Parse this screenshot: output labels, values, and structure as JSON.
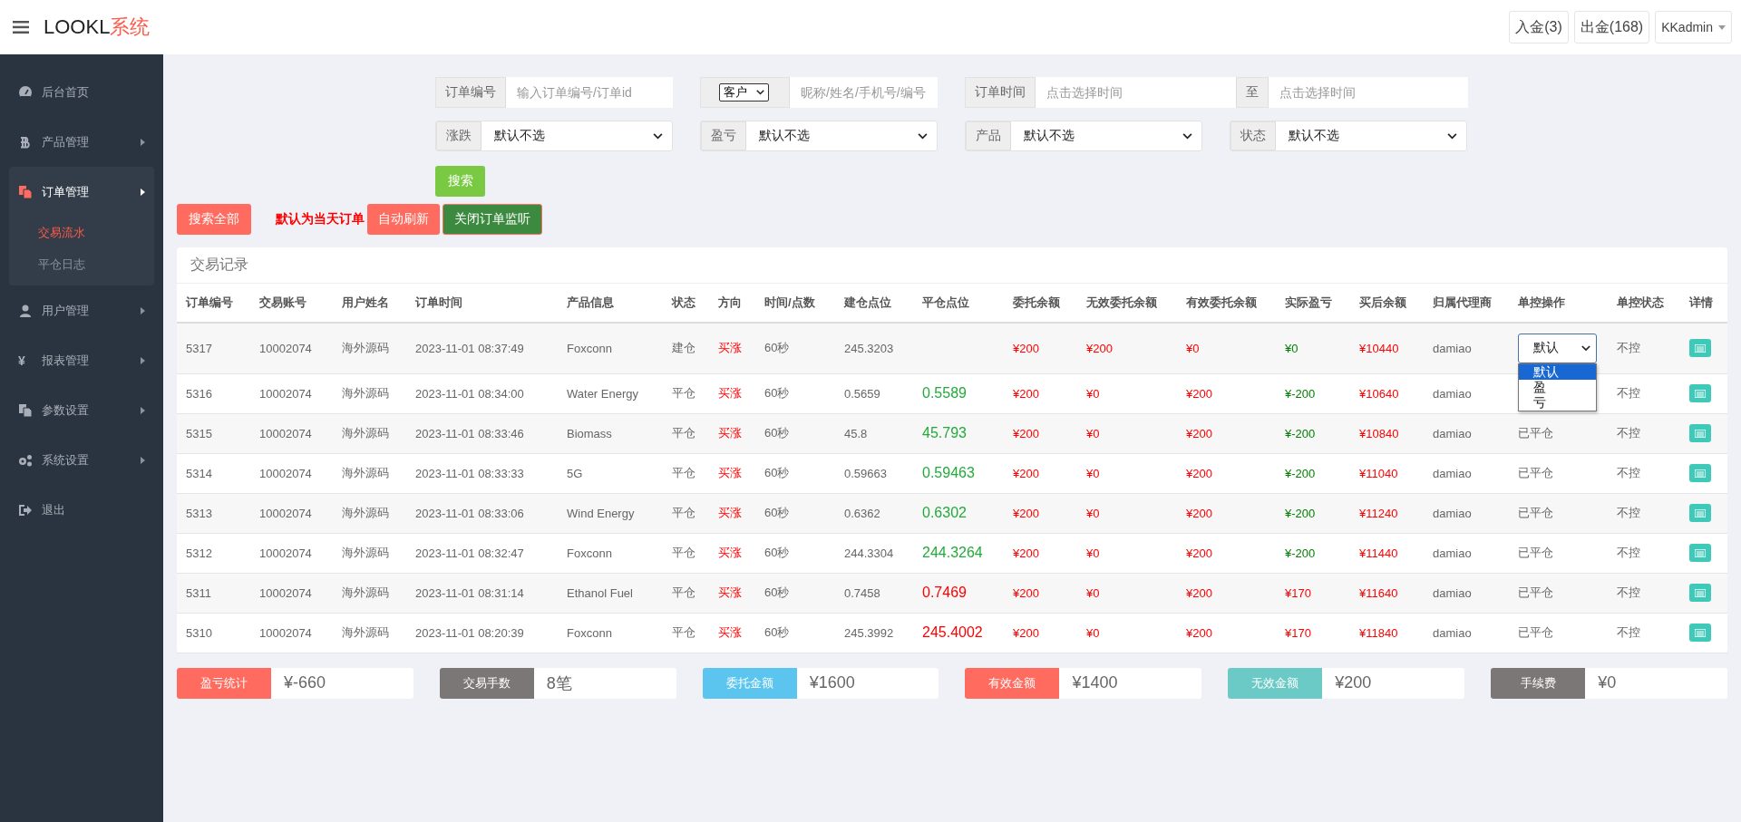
{
  "header": {
    "logo_main": "LOOKL",
    "logo_accent": "系统",
    "buttons": [
      "入金(3)",
      "出金(168)"
    ],
    "user": "KKadmin"
  },
  "sidebar": {
    "items": [
      {
        "label": "后台首页",
        "arrow": false,
        "expanded": false
      },
      {
        "label": "产品管理",
        "arrow": true,
        "expanded": false
      },
      {
        "label": "订单管理",
        "arrow": true,
        "expanded": true,
        "children": [
          {
            "label": "交易流水",
            "selected": true
          },
          {
            "label": "平仓日志",
            "selected": false
          }
        ]
      },
      {
        "label": "用户管理",
        "arrow": true,
        "expanded": false
      },
      {
        "label": "报表管理",
        "arrow": true,
        "expanded": false,
        "glyph": "¥"
      },
      {
        "label": "参数设置",
        "arrow": true,
        "expanded": false
      },
      {
        "label": "系统设置",
        "arrow": true,
        "expanded": false
      },
      {
        "label": "退出",
        "arrow": false,
        "expanded": false
      }
    ]
  },
  "filters": {
    "row1": [
      {
        "kind": "text",
        "label": "订单编号",
        "placeholder": "输入订单编号/订单id"
      },
      {
        "kind": "select-text",
        "select": "客户",
        "placeholder": "昵称/姓名/手机号/编号"
      },
      {
        "kind": "range",
        "label": "订单时间",
        "placeholder": "点击选择时间",
        "separator": "至",
        "placeholder2": "点击选择时间"
      }
    ],
    "row2": [
      {
        "label": "涨跌",
        "value": "默认不选"
      },
      {
        "label": "盈亏",
        "value": "默认不选"
      },
      {
        "label": "产品",
        "value": "默认不选"
      },
      {
        "label": "状态",
        "value": "默认不选"
      }
    ],
    "search_button": "搜索"
  },
  "actions": {
    "search_all": "搜索全部",
    "note": "默认为当天订单",
    "auto_refresh": "自动刷新",
    "close_monitor": "关闭订单监听"
  },
  "table": {
    "title": "交易记录",
    "columns": [
      "订单编号",
      "交易账号",
      "用户姓名",
      "订单时间",
      "产品信息",
      "状态",
      "方向",
      "时间/点数",
      "建仓点位",
      "平仓点位",
      "委托余额",
      "无效委托余额",
      "有效委托余额",
      "实际盈亏",
      "买后余额",
      "归属代理商",
      "单控操作",
      "单控状态",
      "详情"
    ],
    "rows": [
      {
        "id": "5317",
        "account": "10002074",
        "user": "海外源码",
        "time": "2023-11-01 08:37:49",
        "product": "Foxconn",
        "status": "建仓",
        "direction": "买涨",
        "duration": "60秒",
        "open": "245.3203",
        "entrust": "¥200",
        "invalid": "¥200",
        "valid": "¥0",
        "pnl": "¥0",
        "kind": "even",
        "balance": "¥10440",
        "agent": "damiao",
        "control": {
          "kind": "select",
          "value": "默认",
          "open": true,
          "options": [
            {
              "label": "默认",
              "selected": true
            },
            {
              "label": "盈",
              "selected": false
            },
            {
              "label": "亏",
              "selected": false
            }
          ]
        },
        "control_status": "不控"
      },
      {
        "id": "5316",
        "account": "10002074",
        "user": "海外源码",
        "time": "2023-11-01 08:34:00",
        "product": "Water Energy",
        "status": "平仓",
        "direction": "买涨",
        "duration": "60秒",
        "open": "0.5659",
        "close": "0.5589",
        "kind": "loss",
        "entrust": "¥200",
        "invalid": "¥0",
        "valid": "¥200",
        "pnl": "¥-200",
        "balance": "¥10640",
        "agent": "damiao",
        "control_status": "不控"
      },
      {
        "id": "5315",
        "account": "10002074",
        "user": "海外源码",
        "time": "2023-11-01 08:33:46",
        "product": "Biomass",
        "status": "平仓",
        "direction": "买涨",
        "duration": "60秒",
        "open": "45.8",
        "close": "45.793",
        "kind": "loss",
        "entrust": "¥200",
        "invalid": "¥0",
        "valid": "¥200",
        "pnl": "¥-200",
        "balance": "¥10840",
        "agent": "damiao",
        "control": {
          "kind": "text",
          "value": "已平仓"
        },
        "control_status": "不控"
      },
      {
        "id": "5314",
        "account": "10002074",
        "user": "海外源码",
        "time": "2023-11-01 08:33:33",
        "product": "5G",
        "status": "平仓",
        "direction": "买涨",
        "duration": "60秒",
        "open": "0.59663",
        "close": "0.59463",
        "kind": "loss",
        "entrust": "¥200",
        "invalid": "¥0",
        "valid": "¥200",
        "pnl": "¥-200",
        "balance": "¥11040",
        "agent": "damiao",
        "control": {
          "kind": "text",
          "value": "已平仓"
        },
        "control_status": "不控"
      },
      {
        "id": "5313",
        "account": "10002074",
        "user": "海外源码",
        "time": "2023-11-01 08:33:06",
        "product": "Wind Energy",
        "status": "平仓",
        "direction": "买涨",
        "duration": "60秒",
        "open": "0.6362",
        "close": "0.6302",
        "kind": "loss",
        "entrust": "¥200",
        "invalid": "¥0",
        "valid": "¥200",
        "pnl": "¥-200",
        "balance": "¥11240",
        "agent": "damiao",
        "control": {
          "kind": "text",
          "value": "已平仓"
        },
        "control_status": "不控"
      },
      {
        "id": "5312",
        "account": "10002074",
        "user": "海外源码",
        "time": "2023-11-01 08:32:47",
        "product": "Foxconn",
        "status": "平仓",
        "direction": "买涨",
        "duration": "60秒",
        "open": "244.3304",
        "close": "244.3264",
        "kind": "loss",
        "entrust": "¥200",
        "invalid": "¥0",
        "valid": "¥200",
        "pnl": "¥-200",
        "balance": "¥11440",
        "agent": "damiao",
        "control": {
          "kind": "text",
          "value": "已平仓"
        },
        "control_status": "不控"
      },
      {
        "id": "5311",
        "account": "10002074",
        "user": "海外源码",
        "time": "2023-11-01 08:31:14",
        "product": "Ethanol Fuel",
        "status": "平仓",
        "direction": "买涨",
        "duration": "60秒",
        "open": "0.7458",
        "close": "0.7469",
        "kind": "gain",
        "entrust": "¥200",
        "invalid": "¥0",
        "valid": "¥200",
        "pnl": "¥170",
        "balance": "¥11640",
        "agent": "damiao",
        "control": {
          "kind": "text",
          "value": "已平仓"
        },
        "control_status": "不控"
      },
      {
        "id": "5310",
        "account": "10002074",
        "user": "海外源码",
        "time": "2023-11-01 08:20:39",
        "product": "Foxconn",
        "status": "平仓",
        "direction": "买涨",
        "duration": "60秒",
        "open": "245.3992",
        "close": "245.4002",
        "kind": "gain",
        "entrust": "¥200",
        "invalid": "¥0",
        "valid": "¥200",
        "pnl": "¥170",
        "balance": "¥11840",
        "agent": "damiao",
        "control": {
          "kind": "text",
          "value": "已平仓"
        },
        "control_status": "不控"
      }
    ]
  },
  "stats": [
    {
      "label": "盈亏统计",
      "value": "¥-660",
      "color": "#ff6b5e"
    },
    {
      "label": "交易手数",
      "value": "8笔",
      "color": "#7b7776"
    },
    {
      "label": "委托金额",
      "value": "¥1600",
      "color": "#5bc5ef"
    },
    {
      "label": "有效金额",
      "value": "¥1400",
      "color": "#ff6b5e"
    },
    {
      "label": "无效金额",
      "value": "¥200",
      "color": "#6ccac6"
    },
    {
      "label": "手续费",
      "value": "¥0",
      "color": "#7b7776"
    }
  ]
}
